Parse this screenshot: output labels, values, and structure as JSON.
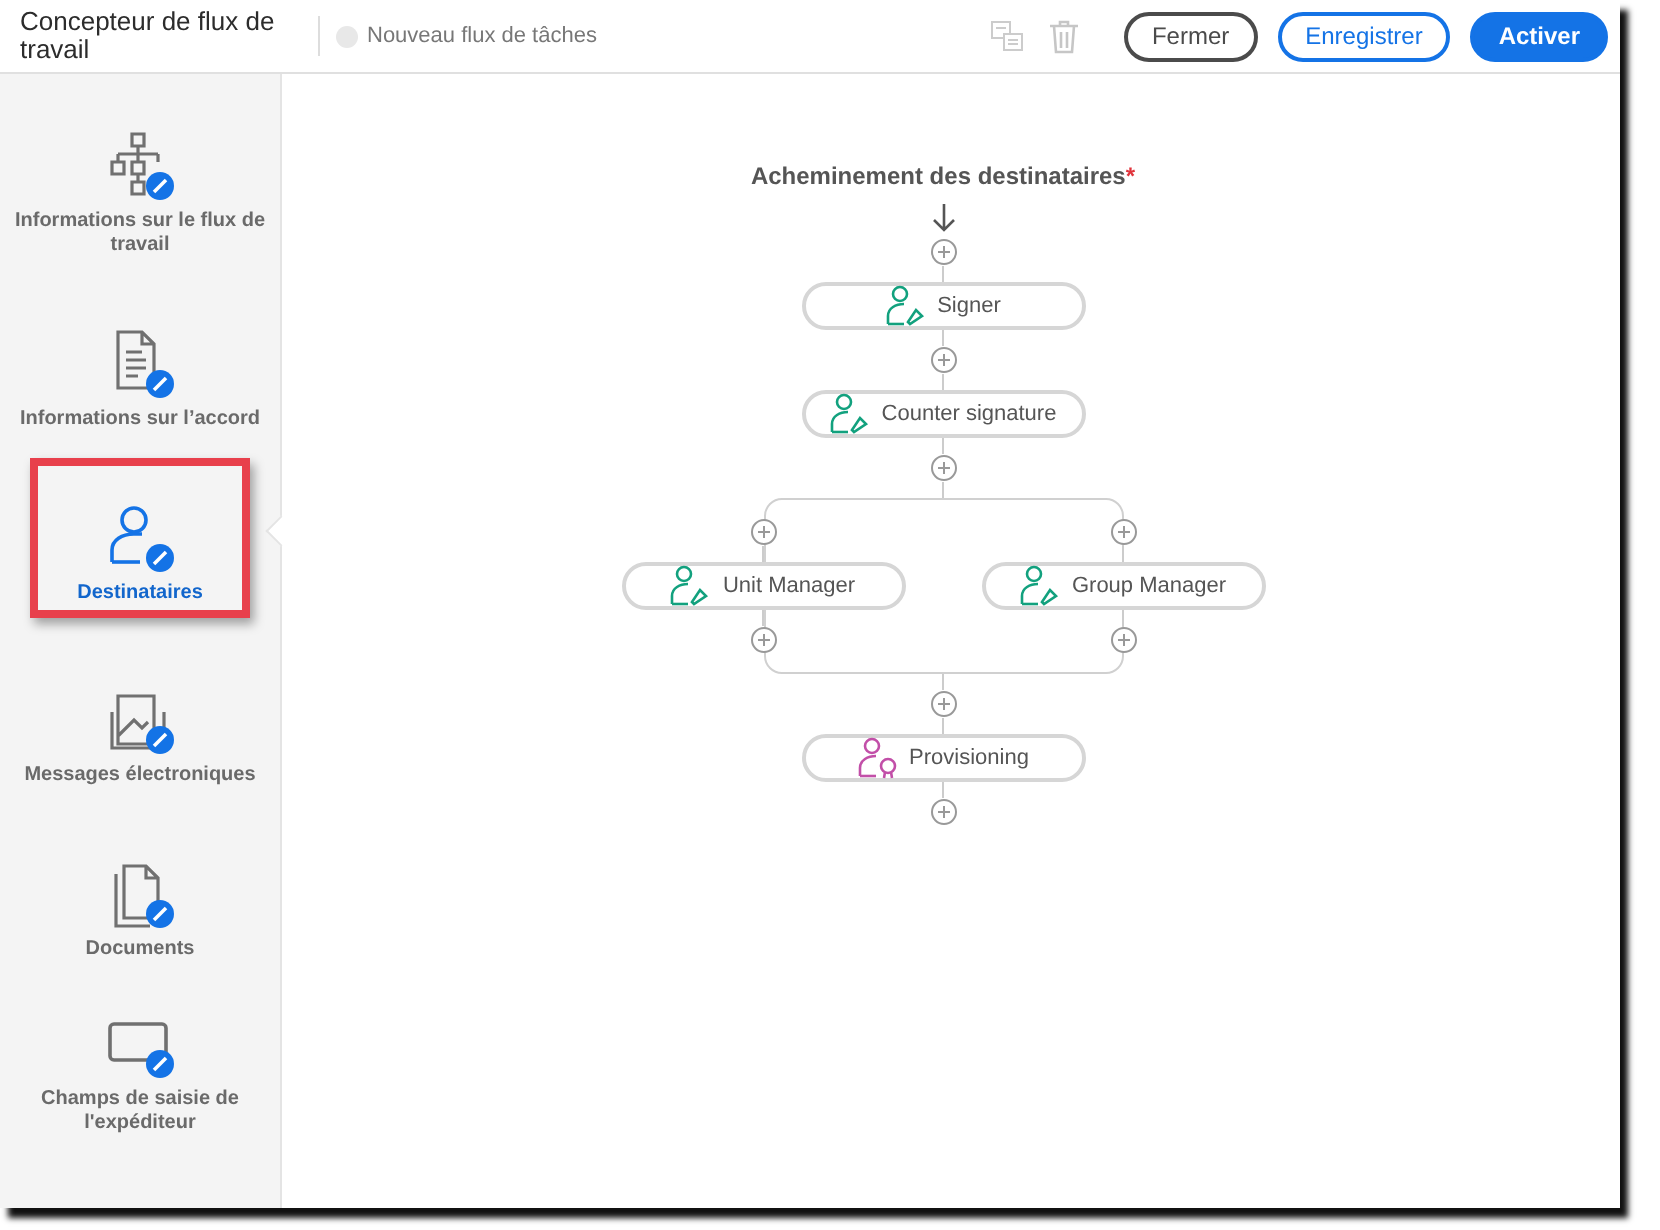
{
  "header": {
    "title": "Concepteur de flux de travail",
    "workflow_name": {
      "placeholder": "Nouveau flux de tâches"
    },
    "buttons": [
      {
        "label": "Fermer",
        "kind": "secondary"
      },
      {
        "label": "Enregistrer",
        "kind": "outline"
      },
      {
        "label": "Activer",
        "kind": "primary"
      }
    ]
  },
  "sidebar": {
    "items": [
      {
        "label": "Informations sur le flux de travail",
        "kind": "hierarchy",
        "selected": false
      },
      {
        "label": "Informations sur l’accord",
        "kind": "document",
        "selected": false
      },
      {
        "label": "Destinataires",
        "kind": "person",
        "selected": true
      },
      {
        "label": "Messages électroniques",
        "kind": "email",
        "selected": false
      },
      {
        "label": "Documents",
        "kind": "files",
        "selected": false
      },
      {
        "label": "Champs de saisie de l'expéditeur",
        "kind": "field",
        "selected": false
      }
    ]
  },
  "routing": {
    "title": "Acheminement des destinataires",
    "required_mark": "*",
    "steps": [
      {
        "kind": "signer",
        "label": "Signer"
      },
      {
        "kind": "signer",
        "label": "Counter signature"
      },
      {
        "kind": "parallel",
        "branches": [
          {
            "kind": "signer",
            "label": "Unit Manager"
          },
          {
            "kind": "signer",
            "label": "Group Manager"
          }
        ]
      },
      {
        "kind": "provisioning",
        "label": "Provisioning"
      }
    ]
  }
}
